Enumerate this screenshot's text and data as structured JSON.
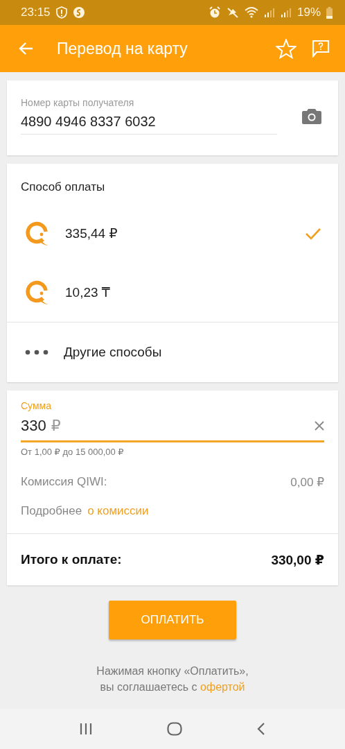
{
  "status_bar": {
    "time": "23:15",
    "battery": "19%"
  },
  "app_bar": {
    "title": "Перевод на карту"
  },
  "card_field": {
    "label": "Номер карты получателя",
    "value": "4890 4946 8337 6032"
  },
  "payment": {
    "title": "Способ оплаты",
    "methods": [
      {
        "kind": "qiwi",
        "label": "335,44 ₽",
        "selected": true
      },
      {
        "kind": "qiwi",
        "label": "10,23 ₸",
        "selected": false
      },
      {
        "kind": "more",
        "label": "Другие способы",
        "selected": false
      }
    ]
  },
  "amount": {
    "label": "Сумма",
    "value": "330",
    "suffix": "₽",
    "focused": true,
    "hint": "От 1,00 ₽ до 15 000,00 ₽"
  },
  "commission": {
    "label": "Комиссия QIWI:",
    "value": "0,00 ₽"
  },
  "details": {
    "label": "Подробнее",
    "link": "о комиссии"
  },
  "total": {
    "label": "Итого к оплате:",
    "value": "330,00 ₽"
  },
  "pay_button": "ОПЛАТИТЬ",
  "disclaimer": {
    "line1": "Нажимая кнопку «Оплатить»,",
    "line2": "вы соглашаетесь с",
    "link": "офертой"
  }
}
